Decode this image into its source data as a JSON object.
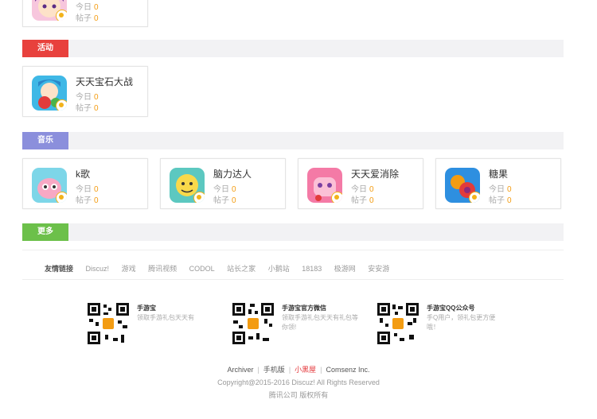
{
  "top_card": {
    "stat_today_label": "今日",
    "stat_today_value": "0",
    "stat_posts_label": "帖子",
    "stat_posts_value": "0"
  },
  "sections": {
    "activity": {
      "tag": "活动",
      "color": "#e8413d",
      "cards": [
        {
          "name": "天天宝石大战",
          "today_label": "今日",
          "today": "0",
          "posts_label": "帖子",
          "posts": "0"
        }
      ]
    },
    "music": {
      "tag": "音乐",
      "color": "#8b8fdc",
      "cards": [
        {
          "name": "k歌",
          "today_label": "今日",
          "today": "0",
          "posts_label": "帖子",
          "posts": "0"
        },
        {
          "name": "脑力达人",
          "today_label": "今日",
          "today": "0",
          "posts_label": "帖子",
          "posts": "0"
        },
        {
          "name": "天天爱消除",
          "today_label": "今日",
          "today": "0",
          "posts_label": "帖子",
          "posts": "0"
        },
        {
          "name": "糖果",
          "today_label": "今日",
          "today": "0",
          "posts_label": "帖子",
          "posts": "0"
        }
      ]
    },
    "more": {
      "tag": "更多",
      "color": "#6cc04a"
    }
  },
  "friend_links": {
    "lead": "友情链接",
    "items": [
      "Discuz!",
      "游戏",
      "腾讯视频",
      "CODOL",
      "站长之家",
      "小鹅站",
      "18183",
      "极游网",
      "安安游"
    ]
  },
  "qr_blocks": [
    {
      "title": "手游宝",
      "desc": "领取手游礼包天天有"
    },
    {
      "title": "手游宝官方微信",
      "desc": "领取手游礼包天天有礼包等你领!"
    },
    {
      "title": "手游宝QQ公众号",
      "desc": "手Q用户，领礼包更方便哦！"
    }
  ],
  "footer": {
    "links": [
      "Archiver",
      "手机版",
      "小黑屋",
      "Comsenz Inc."
    ],
    "copyright": "Copyright@2015-2016 Discuz! All Rights Reserved",
    "company": "腾讯公司 版权所有"
  },
  "colors": {
    "accent_number": "#f39c12",
    "qr_center": "#f39c12",
    "bar_bg": "#f2f2f4"
  },
  "icons": [
    "game-avatar-icon",
    "gem-battle-icon",
    "k-song-icon",
    "brain-master-icon",
    "love-eliminate-icon",
    "candy-icon",
    "qr-code-icon"
  ]
}
